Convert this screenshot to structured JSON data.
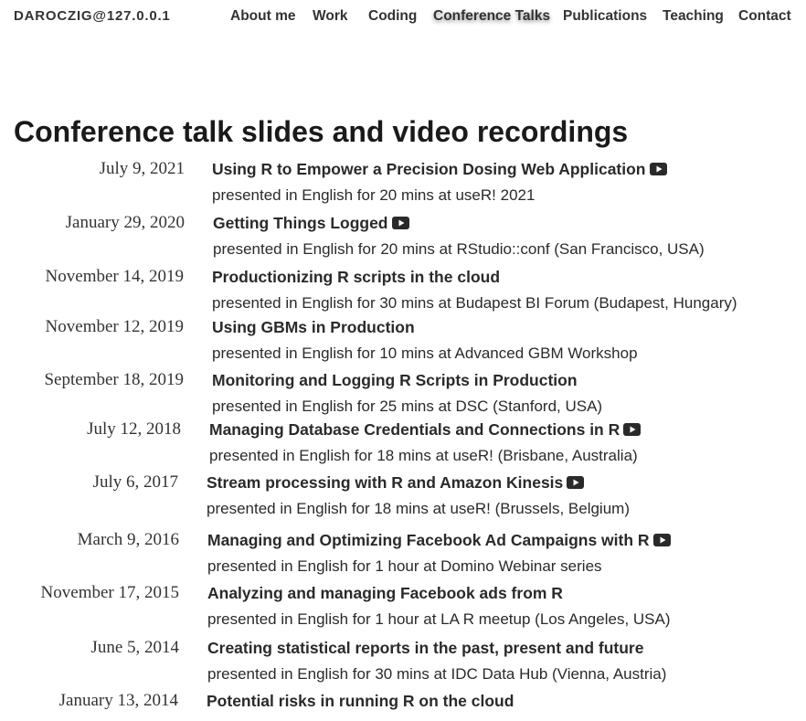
{
  "site": {
    "title": "DAROCZIG@127.0.0.1"
  },
  "nav": {
    "about": "About me",
    "work": "Work",
    "coding": "Coding",
    "talks": "Conference Talks",
    "publications": "Publications",
    "teaching": "Teaching",
    "contact": "Contact"
  },
  "page": {
    "title": "Conference talk slides and video recordings"
  },
  "talks": [
    {
      "date": "July 9, 2021",
      "title": "Using R to Empower a Precision Dosing Web Application",
      "video": true,
      "detail": "presented in English for 20 mins at useR! 2021"
    },
    {
      "date": "January 29, 2020",
      "title": "Getting Things Logged",
      "video": true,
      "detail": "presented in English for 20 mins at RStudio::conf (San Francisco, USA)"
    },
    {
      "date": "November 14, 2019",
      "title": "Productionizing R scripts in the cloud",
      "video": false,
      "detail": "presented in English for 30 mins at Budapest BI Forum (Budapest, Hungary)"
    },
    {
      "date": "November 12, 2019",
      "title": "Using GBMs in Production",
      "video": false,
      "detail": "presented in English for 10 mins at Advanced GBM Workshop"
    },
    {
      "date": "September 18, 2019",
      "title": "Monitoring and Logging R Scripts in Production",
      "video": false,
      "detail": "presented in English for 25 mins at DSC (Stanford, USA)"
    },
    {
      "date": "July 12, 2018",
      "title": "Managing Database Credentials and Connections in R",
      "video": true,
      "detail": "presented in English for 18 mins at useR! (Brisbane, Australia)"
    },
    {
      "date": "July 6, 2017",
      "title": "Stream processing with R and Amazon Kinesis",
      "video": true,
      "detail": "presented in English for 18 mins at useR! (Brussels, Belgium)"
    },
    {
      "date": "March 9, 2016",
      "title": "Managing and Optimizing Facebook Ad Campaigns with R",
      "video": true,
      "detail": "presented in English for 1 hour at Domino Webinar series"
    },
    {
      "date": "November 17, 2015",
      "title": "Analyzing and managing Facebook ads from R",
      "video": false,
      "detail": "presented in English for 1 hour at LA R meetup (Los Angeles, USA)"
    },
    {
      "date": "June 5, 2014",
      "title": "Creating statistical reports in the past, present and future",
      "video": false,
      "detail": "presented in English for 30 mins at IDC Data Hub (Vienna, Austria)"
    },
    {
      "date": "January 13, 2014",
      "title": "Potential risks in running R on the cloud",
      "video": false,
      "detail": ""
    }
  ]
}
